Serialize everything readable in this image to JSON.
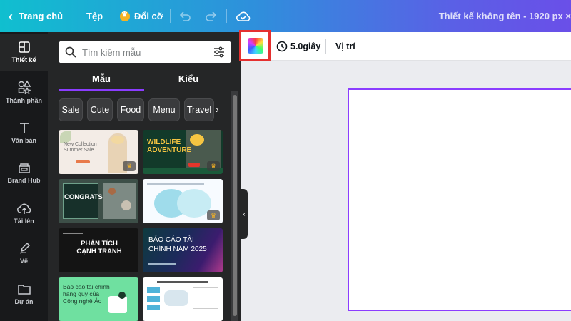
{
  "topbar": {
    "back_label": "Trang chủ",
    "file_label": "Tệp",
    "resize_label": "Đổi cỡ",
    "doc_title": "Thiết kế không tên - 1920 px ×"
  },
  "rail": {
    "items": [
      {
        "label": "Thiết kế"
      },
      {
        "label": "Thành phần"
      },
      {
        "label": "Văn bản"
      },
      {
        "label": "Brand Hub"
      },
      {
        "label": "Tải lên"
      },
      {
        "label": "Vẽ"
      },
      {
        "label": "Dự án"
      }
    ]
  },
  "panel": {
    "search_placeholder": "Tìm kiếm mẫu",
    "tabs": [
      {
        "label": "Mẫu"
      },
      {
        "label": "Kiểu"
      }
    ],
    "chips": [
      "Sale",
      "Cute",
      "Food",
      "Menu",
      "Travel"
    ],
    "templates": [
      {
        "text": "New Collection Summer Sale"
      },
      {
        "text": "WILDLIFE ADVENTURE"
      },
      {
        "text": "CONGRATS!"
      },
      {
        "text": ""
      },
      {
        "text": "PHÂN TÍCH CẠNH TRANH"
      },
      {
        "text": "BÁO CÁO TÀI CHÍNH NĂM 2025"
      },
      {
        "text": "Báo cáo tài chính hàng quý của Công nghệ Ảo"
      },
      {
        "text": ""
      }
    ]
  },
  "editor": {
    "duration": "5.0giây",
    "position_label": "Vị trí"
  },
  "colors": {
    "accent": "#8b3dff",
    "highlight": "#e53030"
  }
}
